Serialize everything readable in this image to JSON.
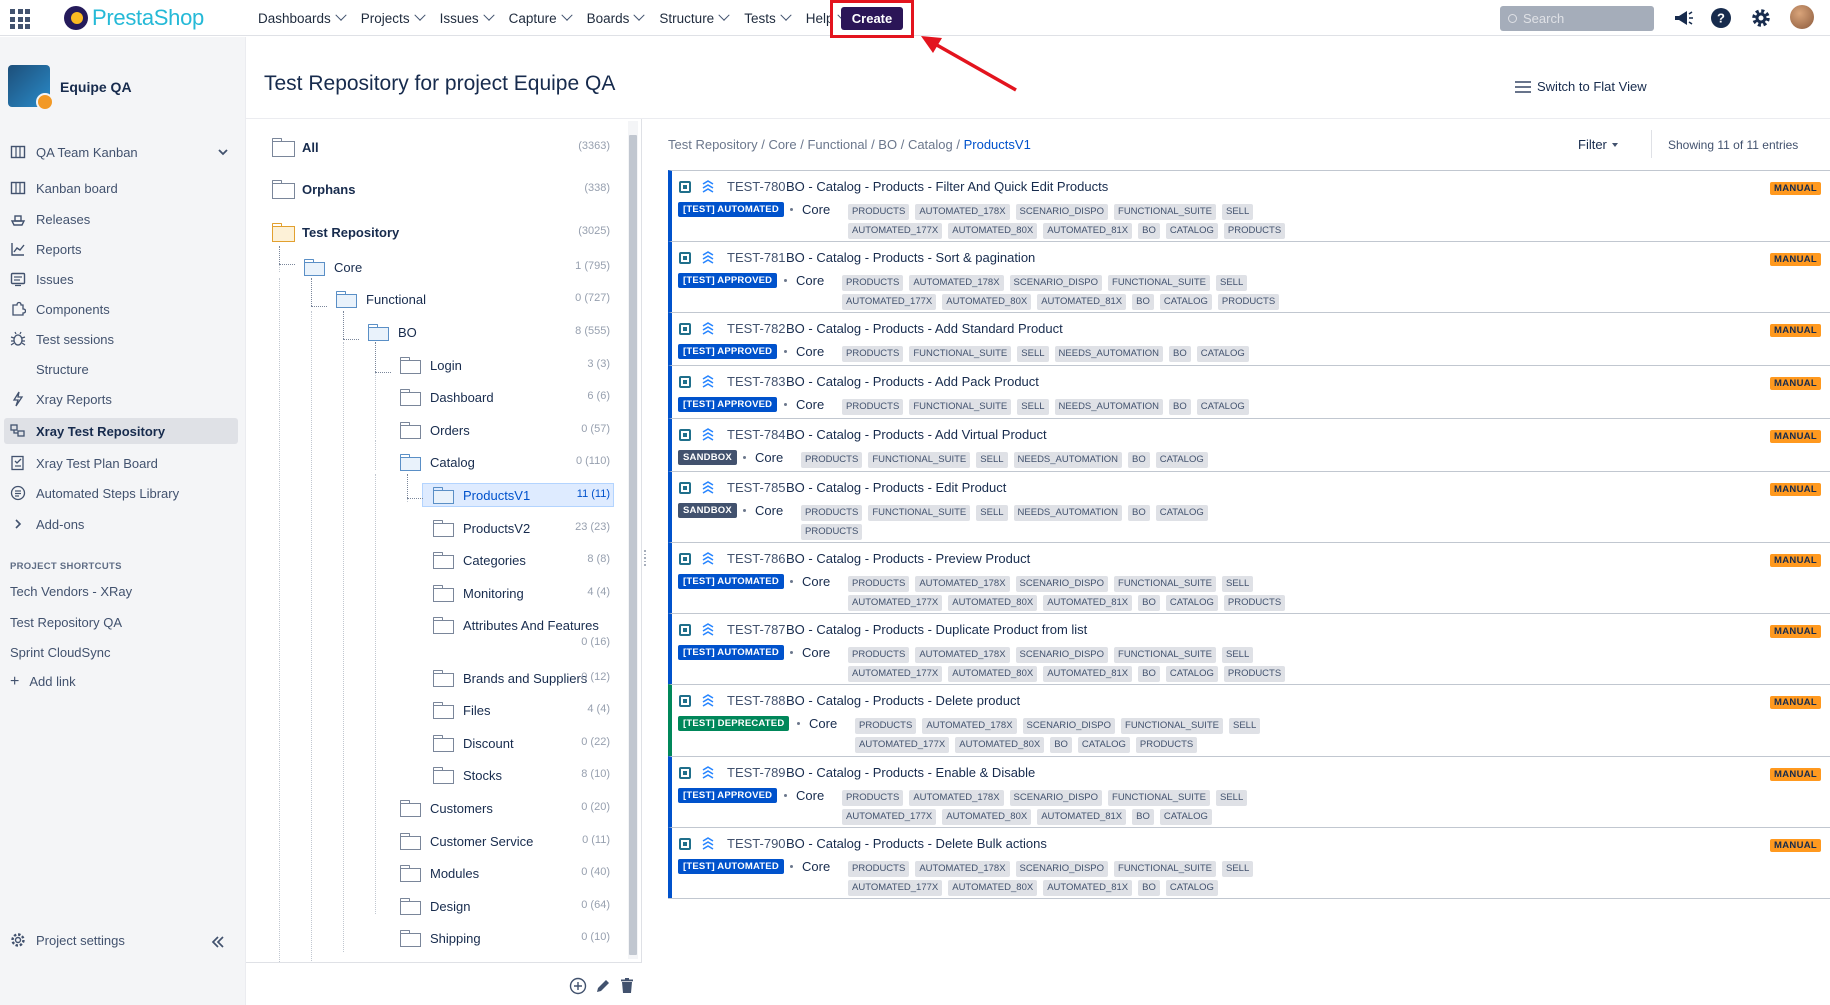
{
  "nav": {
    "logo_text": "PrestaShop",
    "menu": [
      "Dashboards",
      "Projects",
      "Issues",
      "Capture",
      "Boards",
      "Structure",
      "Tests",
      "Help"
    ],
    "create_label": "Create",
    "search_placeholder": "Search"
  },
  "sidebar": {
    "project_name": "Equipe QA",
    "board_selector": "QA Team Kanban",
    "items": [
      {
        "label": "Kanban board",
        "icon": "board-icon"
      },
      {
        "label": "Releases",
        "icon": "ship-icon"
      },
      {
        "label": "Reports",
        "icon": "chart-line-icon"
      },
      {
        "label": "Issues",
        "icon": "issues-icon"
      },
      {
        "label": "Components",
        "icon": "puzzle-icon"
      },
      {
        "label": "Test sessions",
        "icon": "bug-icon"
      },
      {
        "label": "Structure",
        "icon": "blank-icon"
      },
      {
        "label": "Xray Reports",
        "icon": "bolt-icon"
      },
      {
        "label": "Xray Test Repository",
        "icon": "repo-icon"
      },
      {
        "label": "Xray Test Plan Board",
        "icon": "plan-board-icon"
      },
      {
        "label": "Automated Steps Library",
        "icon": "steps-library-icon"
      },
      {
        "label": "Add-ons",
        "icon": "chevron-right-icon"
      }
    ],
    "shortcuts_heading": "PROJECT SHORTCUTS",
    "shortcuts": [
      "Tech Vendors - XRay",
      "Test Repository QA",
      "Sprint CloudSync"
    ],
    "add_link": "Add link",
    "settings_label": "Project settings"
  },
  "page": {
    "title": "Test Repository for project Equipe QA",
    "flat_view_label": "Switch to Flat View"
  },
  "tree": {
    "nodes": [
      {
        "label": "All",
        "count": "(3363)"
      },
      {
        "label": "Orphans",
        "count": "(338)"
      },
      {
        "label": "Test Repository",
        "count": "(3025)"
      },
      {
        "label": "Core",
        "count": "1 (795)"
      },
      {
        "label": "Functional",
        "count": "0 (727)"
      },
      {
        "label": "BO",
        "count": "8 (555)"
      },
      {
        "label": "Login",
        "count": "3 (3)"
      },
      {
        "label": "Dashboard",
        "count": "6 (6)"
      },
      {
        "label": "Orders",
        "count": "0 (57)"
      },
      {
        "label": "Catalog",
        "count": "0 (110)"
      },
      {
        "label": "ProductsV1",
        "count": "11 (11)"
      },
      {
        "label": "ProductsV2",
        "count": "23 (23)"
      },
      {
        "label": "Categories",
        "count": "8 (8)"
      },
      {
        "label": "Monitoring",
        "count": "4 (4)"
      },
      {
        "label": "Attributes And Features",
        "count": "0 (16)"
      },
      {
        "label": "Brands and Suppliers",
        "count": "0 (12)"
      },
      {
        "label": "Files",
        "count": "4 (4)"
      },
      {
        "label": "Discount",
        "count": "0 (22)"
      },
      {
        "label": "Stocks",
        "count": "8 (10)"
      },
      {
        "label": "Customers",
        "count": "0 (20)"
      },
      {
        "label": "Customer Service",
        "count": "0 (11)"
      },
      {
        "label": "Modules",
        "count": "0 (40)"
      },
      {
        "label": "Design",
        "count": "0 (64)"
      },
      {
        "label": "Shipping",
        "count": "0 (10)"
      }
    ]
  },
  "list": {
    "breadcrumb": [
      "Test Repository",
      "Core",
      "Functional",
      "BO",
      "Catalog",
      "ProductsV1"
    ],
    "filter_label": "Filter",
    "showing": "Showing 11 of 11 entries",
    "tests": [
      {
        "key": "TEST-780",
        "title": "BO - Catalog - Products - Filter And Quick Edit Products",
        "status": "[TEST] AUTOMATED",
        "kind": "automated",
        "component": "Core",
        "labels": [
          "PRODUCTS",
          "AUTOMATED_178X",
          "SCENARIO_DISPO",
          "FUNCTIONAL_SUITE",
          "SELL",
          "AUTOMATED_177X",
          "AUTOMATED_80X",
          "AUTOMATED_81X",
          "BO",
          "CATALOG",
          "PRODUCTS"
        ],
        "type": "MANUAL"
      },
      {
        "key": "TEST-781",
        "title": "BO - Catalog - Products - Sort & pagination",
        "status": "[TEST] APPROVED",
        "kind": "approved",
        "component": "Core",
        "labels": [
          "PRODUCTS",
          "AUTOMATED_178X",
          "SCENARIO_DISPO",
          "FUNCTIONAL_SUITE",
          "SELL",
          "AUTOMATED_177X",
          "AUTOMATED_80X",
          "AUTOMATED_81X",
          "BO",
          "CATALOG",
          "PRODUCTS"
        ],
        "type": "MANUAL"
      },
      {
        "key": "TEST-782",
        "title": "BO - Catalog - Products - Add Standard Product",
        "status": "[TEST] APPROVED",
        "kind": "approved",
        "component": "Core",
        "labels": [
          "PRODUCTS",
          "FUNCTIONAL_SUITE",
          "SELL",
          "NEEDS_AUTOMATION",
          "BO",
          "CATALOG"
        ],
        "type": "MANUAL"
      },
      {
        "key": "TEST-783",
        "title": "BO - Catalog - Products - Add Pack Product",
        "status": "[TEST] APPROVED",
        "kind": "approved",
        "component": "Core",
        "labels": [
          "PRODUCTS",
          "FUNCTIONAL_SUITE",
          "SELL",
          "NEEDS_AUTOMATION",
          "BO",
          "CATALOG"
        ],
        "type": "MANUAL"
      },
      {
        "key": "TEST-784",
        "title": "BO - Catalog - Products - Add Virtual Product",
        "status": "SANDBOX",
        "kind": "sandbox",
        "component": "Core",
        "labels": [
          "PRODUCTS",
          "FUNCTIONAL_SUITE",
          "SELL",
          "NEEDS_AUTOMATION",
          "BO",
          "CATALOG"
        ],
        "type": "MANUAL"
      },
      {
        "key": "TEST-785",
        "title": "BO - Catalog - Products - Edit Product",
        "status": "SANDBOX",
        "kind": "sandbox",
        "component": "Core",
        "labels": [
          "PRODUCTS",
          "FUNCTIONAL_SUITE",
          "SELL",
          "NEEDS_AUTOMATION",
          "BO",
          "CATALOG",
          "PRODUCTS"
        ],
        "type": "MANUAL"
      },
      {
        "key": "TEST-786",
        "title": "BO - Catalog - Products - Preview Product",
        "status": "[TEST] AUTOMATED",
        "kind": "automated",
        "component": "Core",
        "labels": [
          "PRODUCTS",
          "AUTOMATED_178X",
          "SCENARIO_DISPO",
          "FUNCTIONAL_SUITE",
          "SELL",
          "AUTOMATED_177X",
          "AUTOMATED_80X",
          "AUTOMATED_81X",
          "BO",
          "CATALOG",
          "PRODUCTS"
        ],
        "type": "MANUAL"
      },
      {
        "key": "TEST-787",
        "title": "BO - Catalog - Products - Duplicate Product from list",
        "status": "[TEST] AUTOMATED",
        "kind": "automated",
        "component": "Core",
        "labels": [
          "PRODUCTS",
          "AUTOMATED_178X",
          "SCENARIO_DISPO",
          "FUNCTIONAL_SUITE",
          "SELL",
          "AUTOMATED_177X",
          "AUTOMATED_80X",
          "AUTOMATED_81X",
          "BO",
          "CATALOG",
          "PRODUCTS"
        ],
        "type": "MANUAL"
      },
      {
        "key": "TEST-788",
        "title": "BO - Catalog - Products - Delete product",
        "status": "[TEST] DEPRECATED",
        "kind": "deprecated",
        "component": "Core",
        "labels": [
          "PRODUCTS",
          "AUTOMATED_178X",
          "SCENARIO_DISPO",
          "FUNCTIONAL_SUITE",
          "SELL",
          "AUTOMATED_177X",
          "AUTOMATED_80X",
          "BO",
          "CATALOG",
          "PRODUCTS"
        ],
        "type": "MANUAL"
      },
      {
        "key": "TEST-789",
        "title": "BO - Catalog - Products - Enable & Disable",
        "status": "[TEST] APPROVED",
        "kind": "approved",
        "component": "Core",
        "labels": [
          "PRODUCTS",
          "AUTOMATED_178X",
          "SCENARIO_DISPO",
          "FUNCTIONAL_SUITE",
          "SELL",
          "AUTOMATED_177X",
          "AUTOMATED_80X",
          "AUTOMATED_81X",
          "BO",
          "CATALOG"
        ],
        "type": "MANUAL"
      },
      {
        "key": "TEST-790",
        "title": "BO - Catalog - Products - Delete Bulk actions",
        "status": "[TEST] AUTOMATED",
        "kind": "automated",
        "component": "Core",
        "labels": [
          "PRODUCTS",
          "AUTOMATED_178X",
          "SCENARIO_DISPO",
          "FUNCTIONAL_SUITE",
          "SELL",
          "AUTOMATED_177X",
          "AUTOMATED_80X",
          "AUTOMATED_81X",
          "BO",
          "CATALOG"
        ],
        "type": "MANUAL"
      }
    ]
  },
  "colors": {
    "brand_blue": "#0052cc",
    "create_button": "#2b1557",
    "highlight_red": "#e3141e",
    "manual_badge": "#ff991f",
    "deprecated_green": "#00875a",
    "sandbox_gray": "#42526e"
  }
}
